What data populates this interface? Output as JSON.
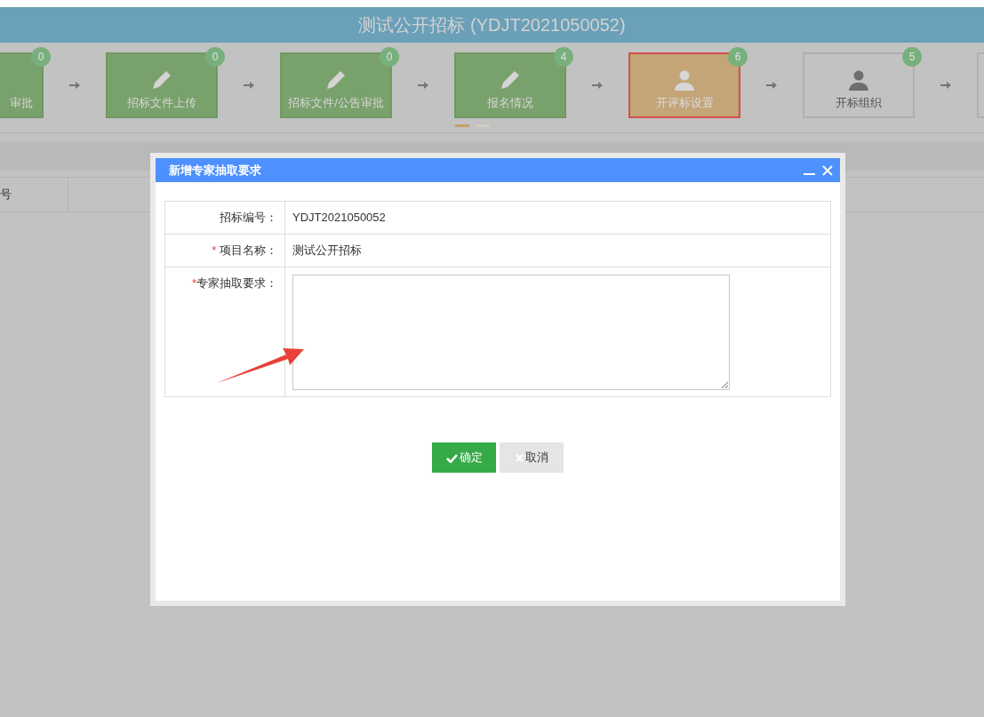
{
  "header": {
    "title": "测试公开招标 (YDJT2021050052)"
  },
  "steps": [
    {
      "label": "审批",
      "badge": "0",
      "done": true,
      "selected": false
    },
    {
      "label": "招标文件上传",
      "badge": "0",
      "done": true,
      "selected": false,
      "kind": "edit"
    },
    {
      "label": "招标文件/公告审批",
      "badge": "0",
      "done": true,
      "selected": false,
      "kind": "edit"
    },
    {
      "label": "报名情况",
      "badge": "4",
      "done": true,
      "selected": false,
      "kind": "edit"
    },
    {
      "label": "开评标设置",
      "badge": "6",
      "done": false,
      "selected": true,
      "kind": "staff"
    },
    {
      "label": "开标组织",
      "badge": "5",
      "done": false,
      "selected": false,
      "kind": "staff"
    },
    {
      "done": false,
      "selected": false
    }
  ],
  "carousel_dots": [
    {
      "selected": true
    },
    {
      "selected": false
    }
  ],
  "table_header": {
    "column_1": "号"
  },
  "dialog": {
    "title": "新增专家抽取要求",
    "fields": [
      {
        "label": "招标编号：",
        "kind": "text",
        "value": "YDJT2021050052"
      },
      {
        "required_mark": "*",
        "label": "项目名称：",
        "kind": "text",
        "value": "测试公开招标"
      },
      {
        "required_mark": "*",
        "label": "专家抽取要求：",
        "kind": "textarea"
      }
    ],
    "buttons": [
      {
        "label": "确定",
        "kind": "confirm"
      },
      {
        "label": "取消",
        "kind": "cancel"
      }
    ]
  }
}
